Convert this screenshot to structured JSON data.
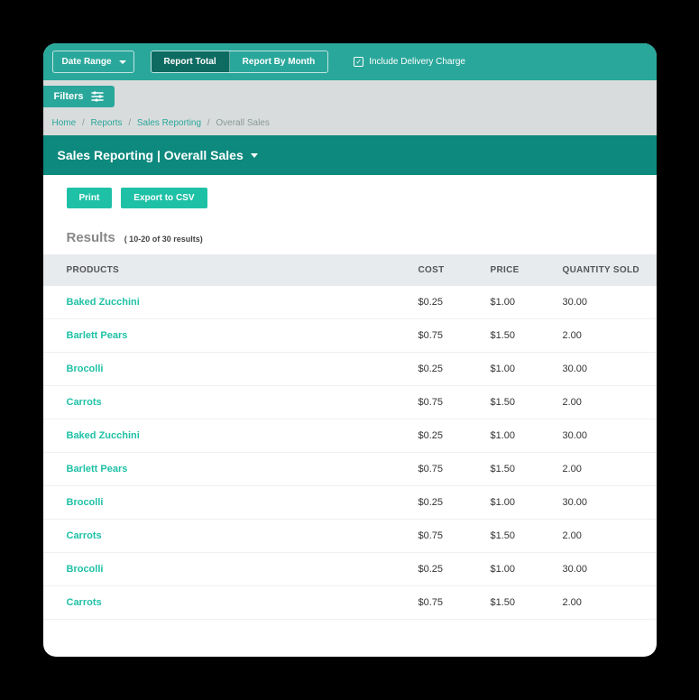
{
  "topbar": {
    "date_range_label": "Date Range",
    "tabs": [
      {
        "label": "Report Total",
        "active": true
      },
      {
        "label": "Report By Month",
        "active": false
      }
    ],
    "checkbox_label": "Include Delivery Charge",
    "checkbox_checked": true
  },
  "filters": {
    "button_label": "Filters"
  },
  "breadcrumb": [
    {
      "label": "Home",
      "link": true
    },
    {
      "label": "Reports",
      "link": true
    },
    {
      "label": "Sales Reporting",
      "link": true
    },
    {
      "label": "Overall Sales",
      "link": false
    }
  ],
  "page_title": "Sales Reporting | Overall Sales",
  "actions": {
    "print_label": "Print",
    "export_label": "Export to CSV"
  },
  "results": {
    "title": "Results",
    "count_text": "( 10-20 of 30 results)"
  },
  "columns": {
    "products": "PRODUCTS",
    "cost": "COST",
    "price": "PRICE",
    "quantity": "QUANTITY SOLD"
  },
  "rows": [
    {
      "product": "Baked Zucchini",
      "cost": "$0.25",
      "price": "$1.00",
      "qty": "30.00"
    },
    {
      "product": "Barlett Pears",
      "cost": "$0.75",
      "price": "$1.50",
      "qty": "2.00"
    },
    {
      "product": "Brocolli",
      "cost": "$0.25",
      "price": "$1.00",
      "qty": "30.00"
    },
    {
      "product": "Carrots",
      "cost": "$0.75",
      "price": "$1.50",
      "qty": "2.00"
    },
    {
      "product": "Baked Zucchini",
      "cost": "$0.25",
      "price": "$1.00",
      "qty": "30.00"
    },
    {
      "product": "Barlett Pears",
      "cost": "$0.75",
      "price": "$1.50",
      "qty": "2.00"
    },
    {
      "product": "Brocolli",
      "cost": "$0.25",
      "price": "$1.00",
      "qty": "30.00"
    },
    {
      "product": "Carrots",
      "cost": "$0.75",
      "price": "$1.50",
      "qty": "2.00"
    },
    {
      "product": "Brocolli",
      "cost": "$0.25",
      "price": "$1.00",
      "qty": "30.00"
    },
    {
      "product": "Carrots",
      "cost": "$0.75",
      "price": "$1.50",
      "qty": "2.00"
    }
  ]
}
